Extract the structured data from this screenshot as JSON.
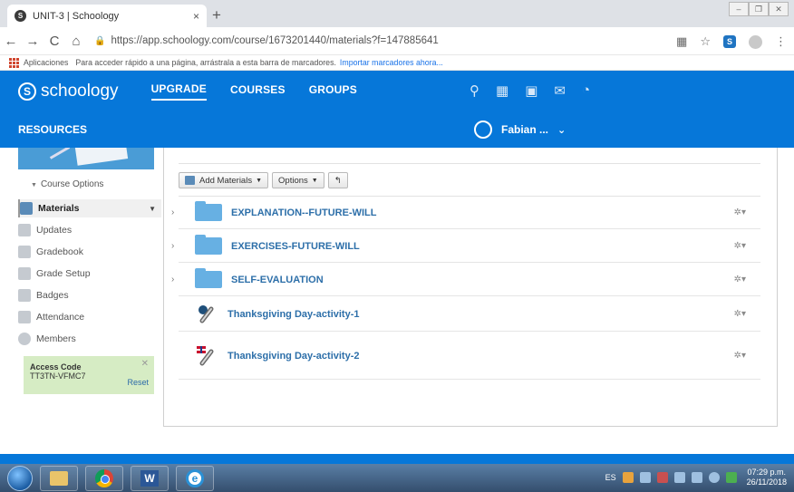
{
  "browser": {
    "tab_title": "UNIT-3 | Schoology",
    "tab_close": "×",
    "new_tab": "+",
    "url": "https://app.schoology.com/course/1673201440/materials?f=147885641",
    "bookmarks_apps": "Aplicaciones",
    "bookmarks_hint": "Para acceder rápido a una página, arrástrala a esta barra de marcadores.",
    "bookmarks_import": "Importar marcadores ahora..."
  },
  "header": {
    "logo": "schoology",
    "nav": [
      "UPGRADE",
      "COURSES",
      "GROUPS"
    ],
    "resources": "RESOURCES",
    "user_name": "Fabian ..."
  },
  "sidebar": {
    "course_options": "Course Options",
    "items": [
      "Materials",
      "Updates",
      "Gradebook",
      "Grade Setup",
      "Badges",
      "Attendance",
      "Members"
    ],
    "access_code_label": "Access Code",
    "access_code": "TT3TN-VFMC7",
    "reset": "Reset"
  },
  "toolbar": {
    "add_materials": "Add Materials",
    "options": "Options",
    "back": "↰"
  },
  "materials": [
    {
      "title": "EXPLANATION--FUTURE-WILL",
      "type": "folder"
    },
    {
      "title": "EXERCISES-FUTURE-WILL",
      "type": "folder"
    },
    {
      "title": "SELF-EVALUATION",
      "type": "folder"
    },
    {
      "title": "Thanksgiving Day-activity-1",
      "type": "link"
    },
    {
      "title": "Thanksgiving Day-activity-2",
      "type": "link"
    }
  ],
  "taskbar": {
    "lang": "ES",
    "time": "07:29 p.m.",
    "date": "26/11/2018"
  },
  "colors": {
    "brand_blue": "#0677d9",
    "link_blue": "#2d6fa9",
    "access_green": "#d6ecc4"
  }
}
